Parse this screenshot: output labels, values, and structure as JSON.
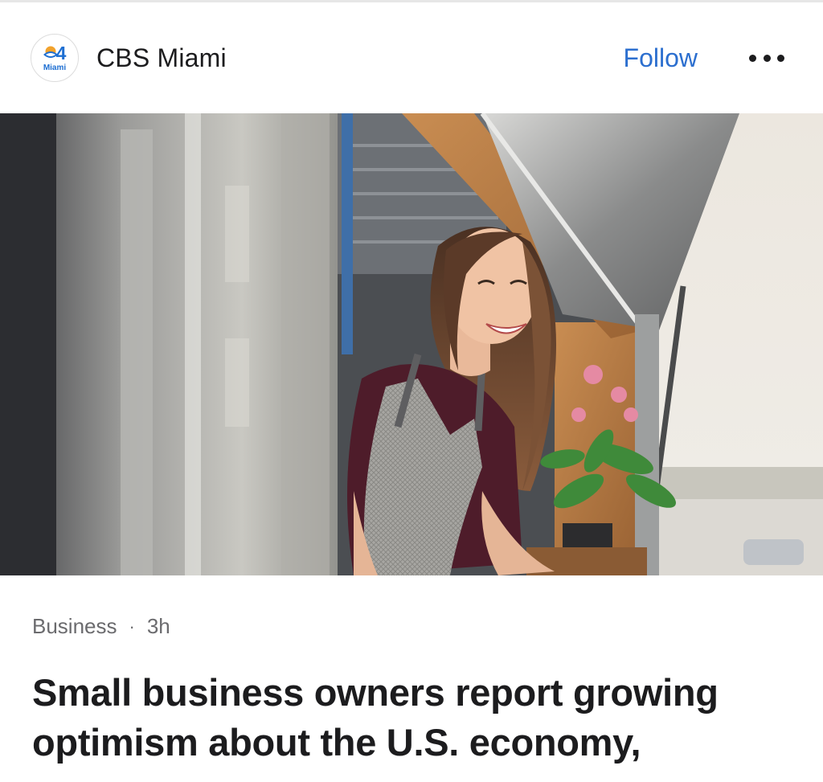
{
  "source": {
    "name": "CBS Miami",
    "logo": {
      "number": "4",
      "text": "Miami",
      "brand_color": "#1e6fd2",
      "accent_color": "#f2a22c"
    }
  },
  "actions": {
    "follow_label": "Follow",
    "more_icon": "more-horizontal-icon"
  },
  "article": {
    "image_alt": "Smiling woman in an apron leaning out of a food truck window",
    "category": "Business",
    "separator": "·",
    "age": "3h",
    "headline": "Small business owners report growing optimism about the U.S. economy,"
  },
  "colors": {
    "link": "#2c6fcf",
    "text": "#1c1c1e",
    "meta": "#6b6b6e"
  }
}
